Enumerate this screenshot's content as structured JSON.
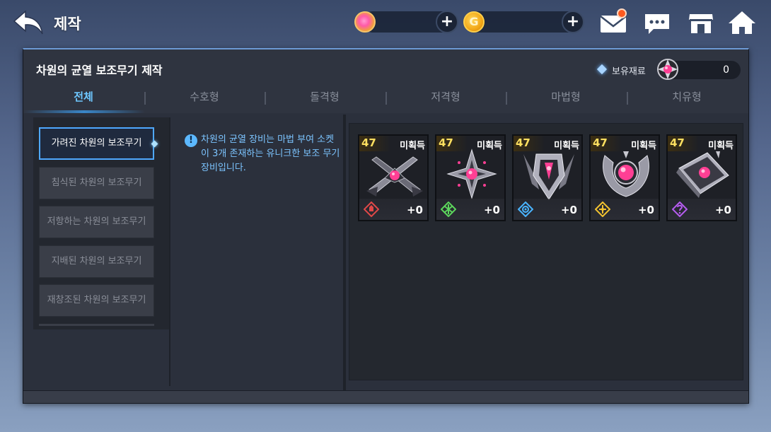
{
  "header": {
    "title": "제작"
  },
  "currencies": [
    {
      "icon": "gem-currency-icon"
    },
    {
      "icon": "gold-currency-icon",
      "glyph": "G"
    }
  ],
  "topbar_icons": [
    "mail-icon",
    "chat-icon",
    "shop-icon",
    "home-icon"
  ],
  "panel": {
    "title": "차원의 균열 보조무기 제작",
    "owned_label": "보유재료",
    "owned_count": "0"
  },
  "tabs": [
    {
      "label": "전체",
      "active": true
    },
    {
      "label": "수호형",
      "active": false
    },
    {
      "label": "돌격형",
      "active": false
    },
    {
      "label": "저격형",
      "active": false
    },
    {
      "label": "마법형",
      "active": false
    },
    {
      "label": "치유형",
      "active": false
    }
  ],
  "categories": [
    {
      "label": "가려진 차원의 보조무기",
      "active": true
    },
    {
      "label": "침식된 차원의 보조무기",
      "active": false
    },
    {
      "label": "저항하는 차원의 보조무기",
      "active": false
    },
    {
      "label": "지배된 차원의 보조무기",
      "active": false
    },
    {
      "label": "재창조된 차원의 보조무기",
      "active": false
    }
  ],
  "info": {
    "icon": "!",
    "text": "차원의 균열 장비는 마법 부여 소켓이 3개 존재하는 유니크한 보조 무기 장비입니다."
  },
  "items": [
    {
      "level": "47",
      "status": "미획득",
      "enhance": "+0",
      "class": "tank",
      "class_color": "#e04848"
    },
    {
      "level": "47",
      "status": "미획득",
      "enhance": "+0",
      "class": "assault",
      "class_color": "#5cd65c"
    },
    {
      "level": "47",
      "status": "미획득",
      "enhance": "+0",
      "class": "sniper",
      "class_color": "#4ab4ff"
    },
    {
      "level": "47",
      "status": "미획득",
      "enhance": "+0",
      "class": "magic",
      "class_color": "#f2c230"
    },
    {
      "level": "47",
      "status": "미획득",
      "enhance": "+0",
      "class": "healer",
      "class_color": "#b65cf0"
    }
  ],
  "colors": {
    "accent": "#6ec7ff",
    "level": "#ffe060",
    "gem": "#ff3f94"
  }
}
